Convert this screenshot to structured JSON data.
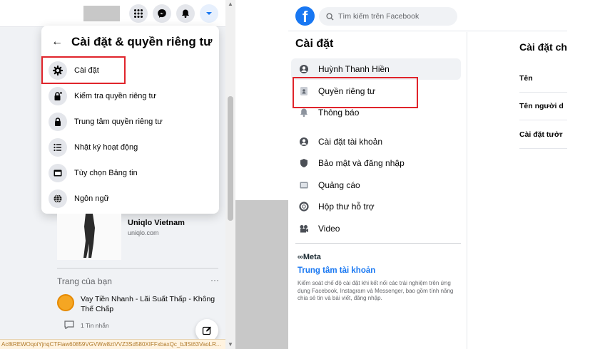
{
  "left_panel": {
    "dropdown": {
      "title": "Cài đặt & quyền riêng tư",
      "items": [
        {
          "label": "Cài đặt",
          "icon": "gear-icon"
        },
        {
          "label": "Kiểm tra quyền riêng tư",
          "icon": "lock-plus-icon"
        },
        {
          "label": "Trung tâm quyền riêng tư",
          "icon": "lock-icon"
        },
        {
          "label": "Nhật ký hoạt động",
          "icon": "list-icon"
        },
        {
          "label": "Tùy chọn Bảng tin",
          "icon": "news-feed-icon"
        },
        {
          "label": "Ngôn ngữ",
          "icon": "globe-icon"
        }
      ]
    },
    "ad": {
      "title": "Uniqlo Vietnam",
      "url": "uniqlo.com"
    },
    "pages_section": {
      "title": "Trang của bạn",
      "more": "···",
      "page_name": "Vay Tiền Nhanh - Lãi Suất Thấp - Không Thế Chấp",
      "messages": "1 Tin nhắn"
    },
    "status_url": "Ac8tREWOqoiYjnqCTFiaw60859VGVWw8ztVVZ3Sd580XIFFxbaxQc_bJlSt63VaoLR..."
  },
  "right_panel": {
    "search": {
      "placeholder": "Tìm kiếm trên Facebook"
    },
    "sidebar": {
      "title": "Cài đặt",
      "items": [
        {
          "label": "Huỳnh Thanh Hiền",
          "icon": "profile-icon"
        },
        {
          "label": "Quyền riêng tư",
          "icon": "privacy-lock-icon"
        },
        {
          "label": "Thông báo",
          "icon": "bell-icon"
        },
        {
          "label": "Cài đặt tài khoản",
          "icon": "account-icon"
        },
        {
          "label": "Bảo mật và đăng nhập",
          "icon": "shield-icon"
        },
        {
          "label": "Quảng cáo",
          "icon": "ads-icon"
        },
        {
          "label": "Hộp thư hỗ trợ",
          "icon": "lifebuoy-icon"
        },
        {
          "label": "Video",
          "icon": "video-icon"
        }
      ]
    },
    "meta": {
      "logo": "∞Meta",
      "link": "Trung tâm tài khoản",
      "description": "Kiểm soát chế độ cài đặt khi kết nối các trải nghiệm trên ứng dụng Facebook, Instagram và Messenger, bao gồm tính năng chia sẻ tin và bài viết, đăng nhập."
    },
    "content": {
      "title": "Cài đặt ch",
      "rows": [
        "Tên",
        "Tên người d",
        "Cài đặt tưởr"
      ]
    }
  },
  "colors": {
    "highlight_border": "#e0242b",
    "facebook_blue": "#1877f2"
  }
}
